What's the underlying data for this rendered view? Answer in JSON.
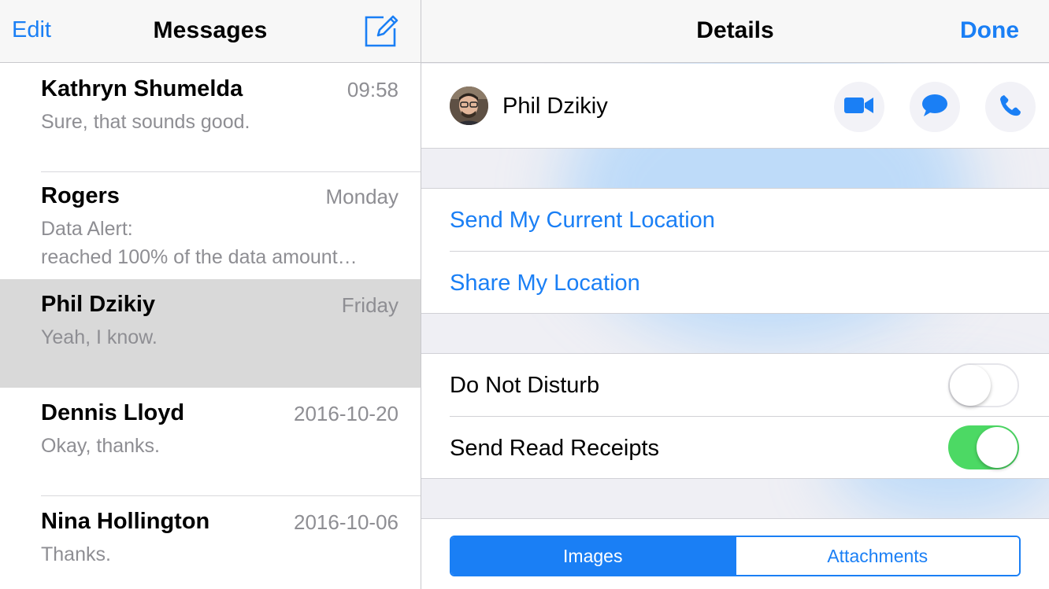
{
  "messages_pane": {
    "edit_label": "Edit",
    "title": "Messages",
    "compose_icon": "compose-icon",
    "conversations": [
      {
        "name": "Kathryn Shumelda",
        "time": "09:58",
        "preview_line1": "Sure, that sounds good.",
        "preview_line2": "",
        "selected": false
      },
      {
        "name": "Rogers",
        "time": "Monday",
        "preview_line1": "Data Alert:",
        "preview_line2": "reached 100% of the data amount…",
        "selected": false
      },
      {
        "name": "Phil Dzikiy",
        "time": "Friday",
        "preview_line1": "Yeah, I know.",
        "preview_line2": "",
        "selected": true
      },
      {
        "name": "Dennis Lloyd",
        "time": "2016-10-20",
        "preview_line1": "Okay, thanks.",
        "preview_line2": "",
        "selected": false
      },
      {
        "name": "Nina Hollington",
        "time": "2016-10-06",
        "preview_line1": "Thanks.",
        "preview_line2": "",
        "selected": false
      }
    ]
  },
  "details_pane": {
    "title": "Details",
    "done_label": "Done",
    "contact": {
      "name": "Phil Dzikiy",
      "actions": [
        "video-camera-icon",
        "message-bubble-icon",
        "phone-icon"
      ]
    },
    "location": {
      "send_current": "Send My Current Location",
      "share": "Share My Location"
    },
    "settings": [
      {
        "label": "Do Not Disturb",
        "on": false
      },
      {
        "label": "Send Read Receipts",
        "on": true
      }
    ],
    "segments": {
      "images": "Images",
      "attachments": "Attachments",
      "selected": "Images"
    }
  },
  "colors": {
    "accent": "#1a7ff5",
    "switch_on": "#4cd964",
    "selected_row": "#d9d9d9",
    "secondary_text": "#8e8e93"
  }
}
